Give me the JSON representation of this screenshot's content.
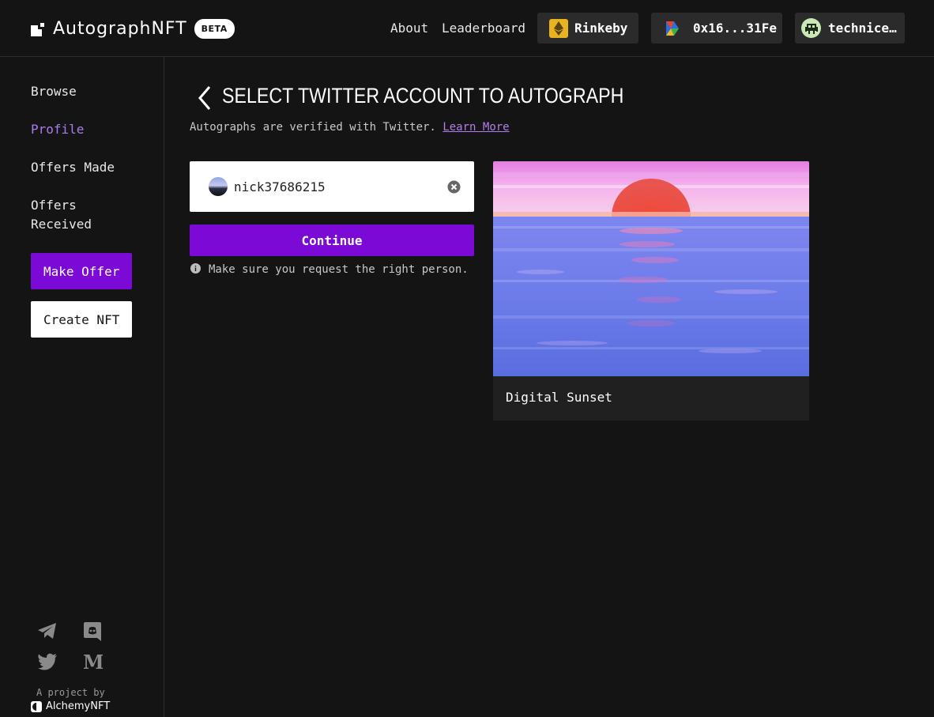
{
  "header": {
    "brand": "AutographNFT",
    "beta": "BETA",
    "nav": {
      "about": "About",
      "leaderboard": "Leaderboard"
    },
    "network": "Rinkeby",
    "wallet": "0x16...31Fe",
    "user": "technice…"
  },
  "sidebar": {
    "items": [
      {
        "label": "Browse"
      },
      {
        "label": "Profile"
      },
      {
        "label": "Offers Made"
      },
      {
        "label": "Offers Received"
      }
    ],
    "make_offer": "Make Offer",
    "create_nft": "Create NFT",
    "footer": {
      "project_by": "A project by",
      "partner": "AlchemyNFT"
    },
    "social_icons": [
      "telegram-icon",
      "discord-icon",
      "twitter-icon",
      "medium-icon"
    ]
  },
  "main": {
    "title": "SELECT TWITTER ACCOUNT TO AUTOGRAPH",
    "subtitle": "Autographs are verified with Twitter.",
    "learn_more": "Learn More",
    "account": {
      "handle": "nick37686215"
    },
    "continue": "Continue",
    "hint": "Make sure you request the right person.",
    "nft": {
      "title": "Digital Sunset"
    }
  },
  "colors": {
    "accent": "#7b0ad6",
    "active_nav": "#a97de8",
    "background": "#141414",
    "link": "#b47df0"
  }
}
